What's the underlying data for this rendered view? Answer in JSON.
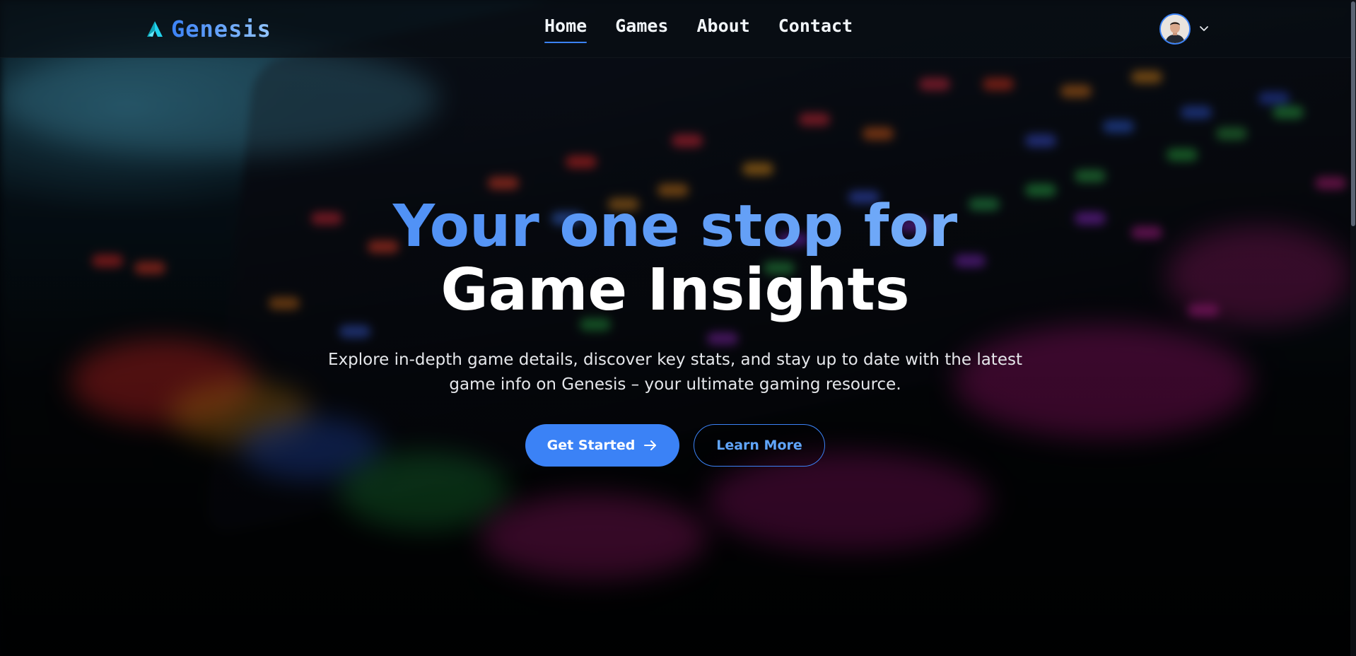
{
  "brand": {
    "name": "Genesis",
    "logo_icon": "genesis-logo-icon"
  },
  "nav": {
    "links": [
      {
        "label": "Home",
        "active": true
      },
      {
        "label": "Games",
        "active": false
      },
      {
        "label": "About",
        "active": false
      },
      {
        "label": "Contact",
        "active": false
      }
    ]
  },
  "user": {
    "avatar_icon": "user-avatar",
    "menu_icon": "chevron-down-icon"
  },
  "hero": {
    "headline_line1": "Your one stop for",
    "headline_line2": "Game Insights",
    "subtitle": "Explore in-depth game details, discover key stats, and stay up to date with the latest game info on Genesis – your ultimate gaming resource.",
    "primary_button": {
      "label": "Get Started",
      "icon": "arrow-right-icon"
    },
    "secondary_button": {
      "label": "Learn More"
    }
  },
  "colors": {
    "accent": "#3b82f6",
    "accent_light": "#93c5fd",
    "text": "#ffffff",
    "nav_bg": "#080e14"
  }
}
